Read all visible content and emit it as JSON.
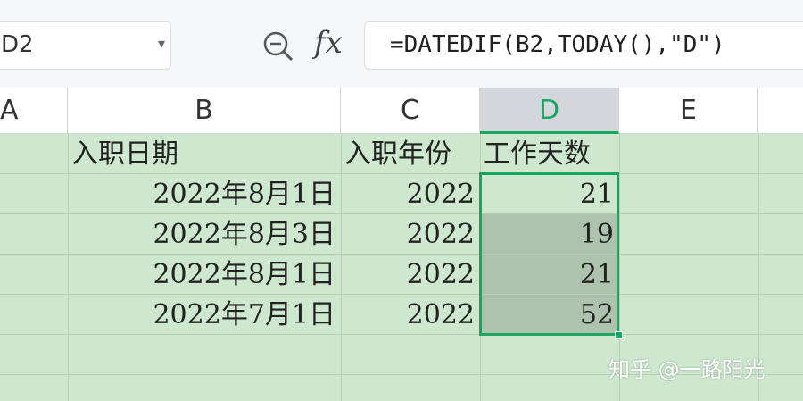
{
  "toolbar": {
    "name_box": "D2",
    "formula": "=DATEDIF(B2,TODAY(),\"D\")",
    "fx_label": "fx"
  },
  "columns": [
    "A",
    "B",
    "C",
    "D",
    "E"
  ],
  "active_column": "D",
  "rows": [
    [
      "",
      "入职日期",
      "入职年份",
      "工作天数"
    ],
    [
      "",
      "2022年8月1日",
      "2022",
      "21"
    ],
    [
      "",
      "2022年8月3日",
      "2022",
      "19"
    ],
    [
      "",
      "2022年8月1日",
      "2022",
      "21"
    ],
    [
      "",
      "2022年7月1日",
      "2022",
      "52"
    ]
  ],
  "watermark": "知乎 @一路阳光",
  "colors": {
    "accent": "#1aa560",
    "grid_bg": "#cde8cf",
    "selection": "#aec3ae"
  }
}
